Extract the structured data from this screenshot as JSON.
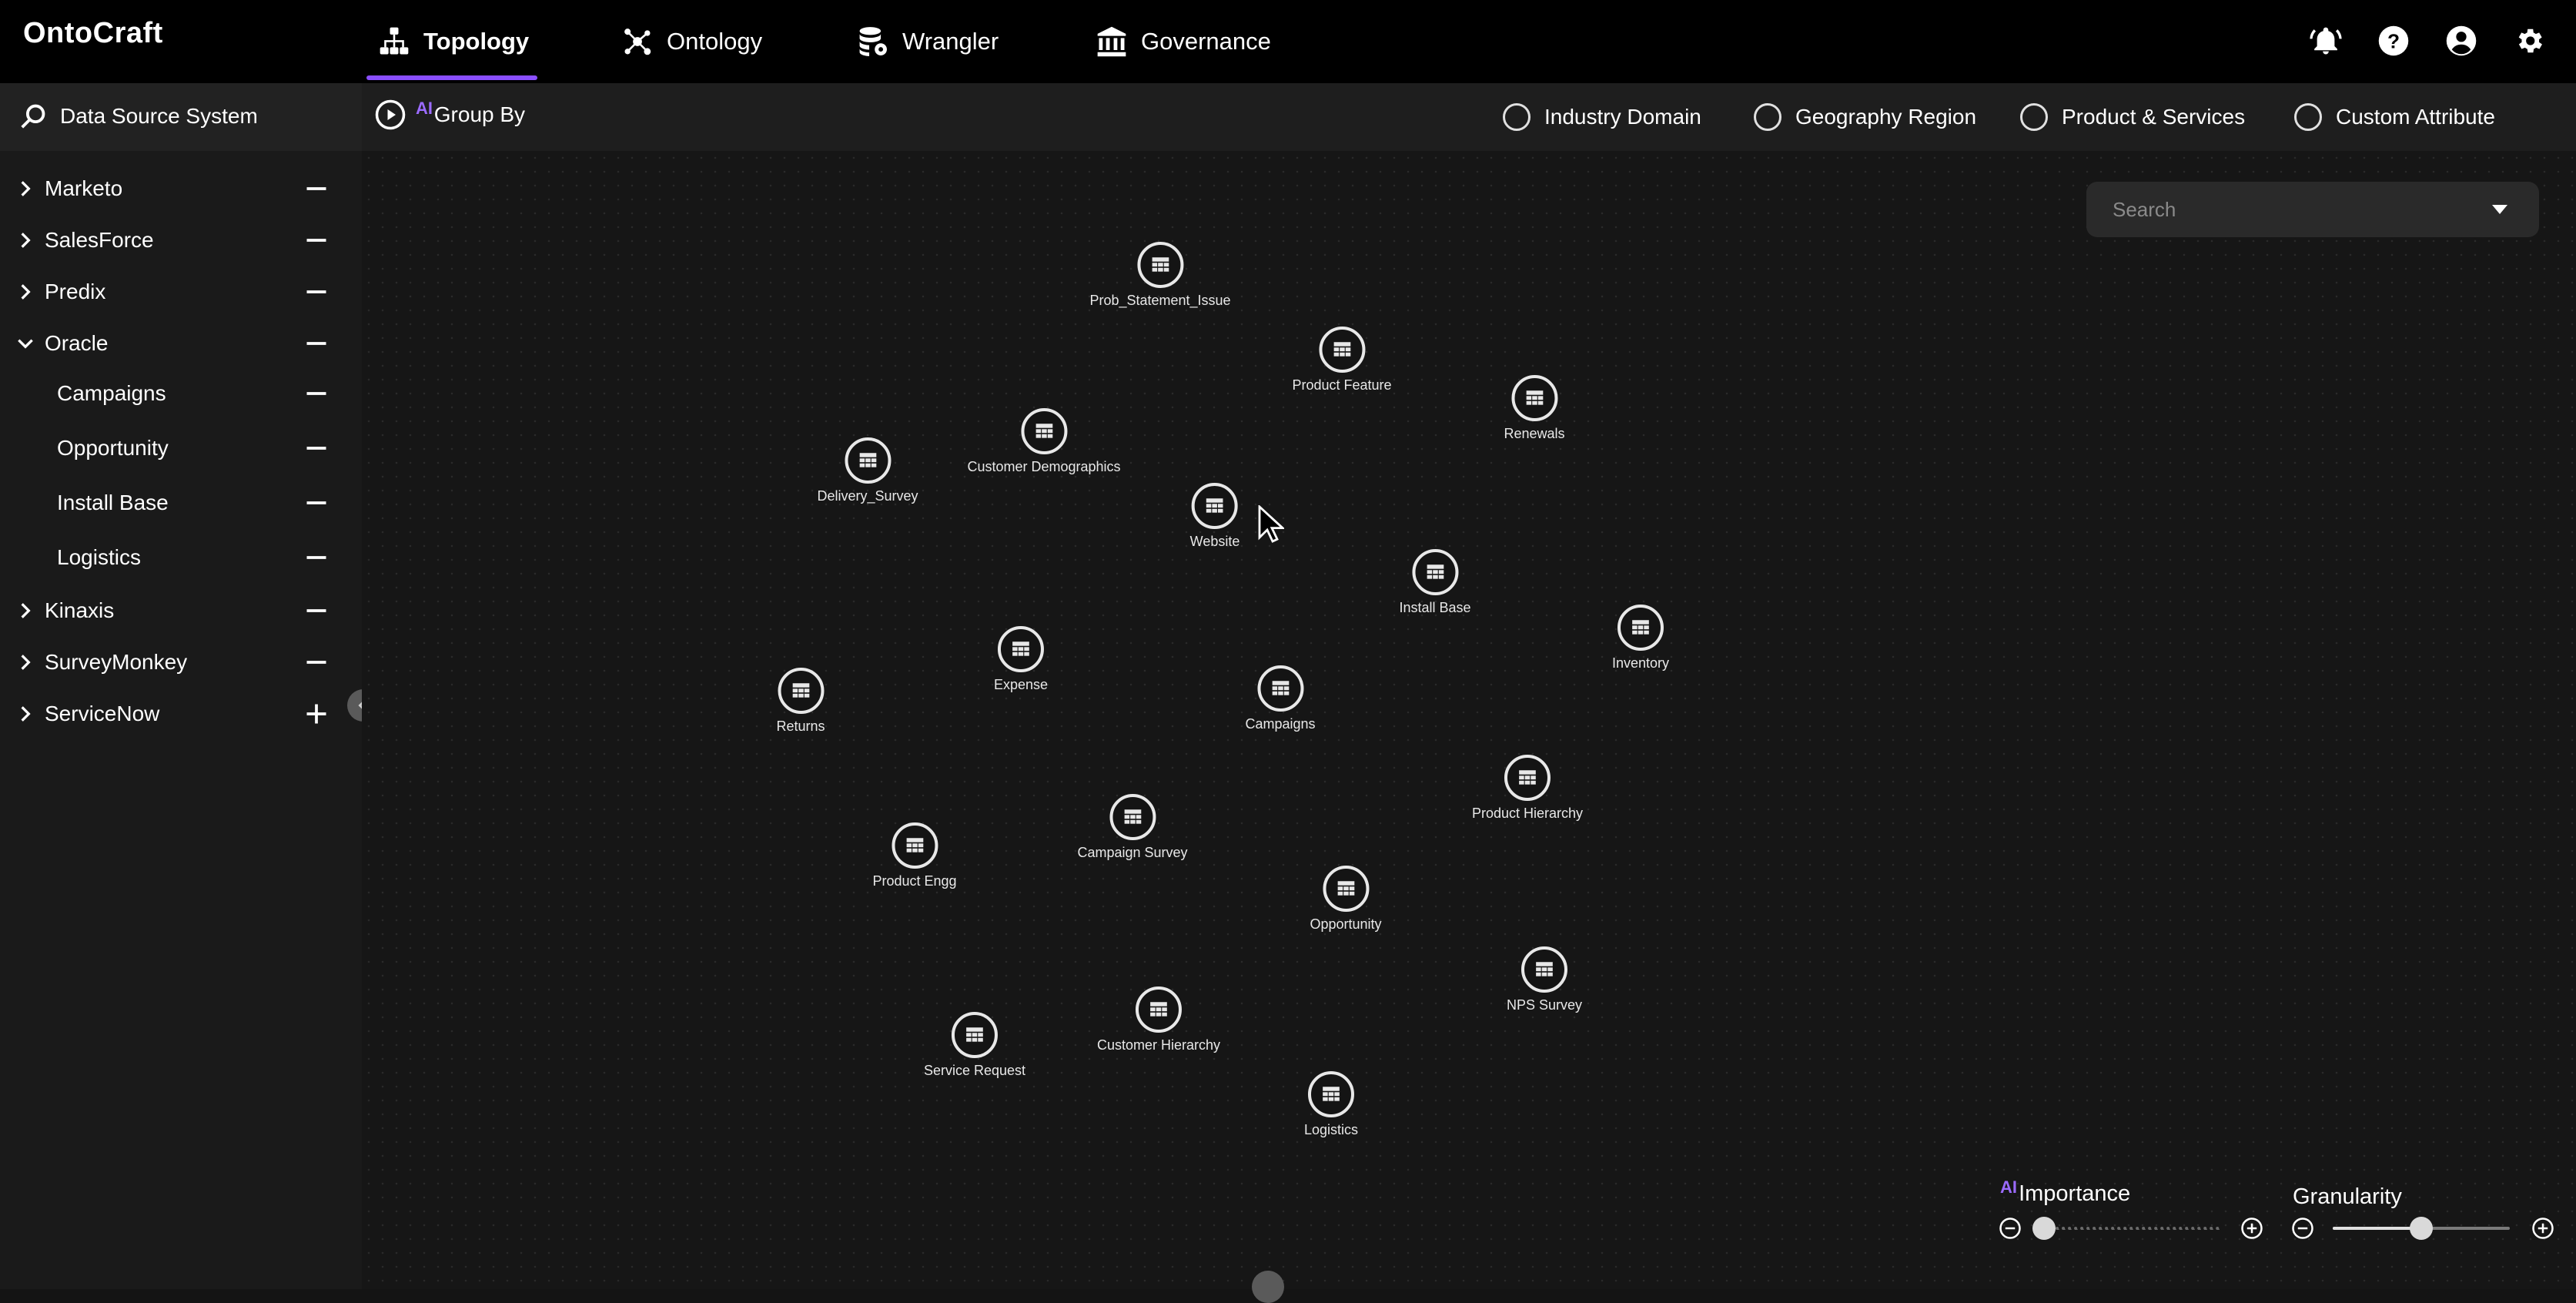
{
  "app": {
    "logo": "OntoCraft",
    "accent": "#8a4fff"
  },
  "nav": {
    "tabs": [
      {
        "label": "Topology",
        "icon": "topology-icon",
        "active": true
      },
      {
        "label": "Ontology",
        "icon": "ontology-icon",
        "active": false
      },
      {
        "label": "Wrangler",
        "icon": "database-gear-icon",
        "active": false
      },
      {
        "label": "Governance",
        "icon": "bank-icon",
        "active": false
      }
    ],
    "right_icons": [
      "bell-icon",
      "help-icon",
      "account-icon",
      "gear-icon"
    ]
  },
  "toolbar": {
    "data_source_label": "Data Source System",
    "ai_tag": "AI",
    "group_by_label": "Group By",
    "group_options": [
      {
        "label": "Industry Domain",
        "selected": false
      },
      {
        "label": "Geography Region",
        "selected": false
      },
      {
        "label": "Product & Services",
        "selected": false
      },
      {
        "label": "Custom Attribute",
        "selected": false
      }
    ]
  },
  "sidebar": {
    "items": [
      {
        "label": "Marketo",
        "expanded": false,
        "action": "minus"
      },
      {
        "label": "SalesForce",
        "expanded": false,
        "action": "minus"
      },
      {
        "label": "Predix",
        "expanded": false,
        "action": "minus"
      },
      {
        "label": "Oracle",
        "expanded": true,
        "action": "minus"
      },
      {
        "label": "Campaigns",
        "child": true,
        "action": "minus"
      },
      {
        "label": "Opportunity",
        "child": true,
        "action": "minus"
      },
      {
        "label": "Install Base",
        "child": true,
        "action": "minus"
      },
      {
        "label": "Logistics",
        "child": true,
        "action": "minus"
      },
      {
        "label": "Kinaxis",
        "expanded": false,
        "action": "minus"
      },
      {
        "label": "SurveyMonkey",
        "expanded": false,
        "action": "minus"
      },
      {
        "label": "ServiceNow",
        "expanded": false,
        "action": "plus"
      }
    ]
  },
  "search": {
    "placeholder": "Search"
  },
  "nodes": [
    {
      "label": "Prob_Statement_Issue"
    },
    {
      "label": "Product Feature"
    },
    {
      "label": "Renewals"
    },
    {
      "label": "Customer Demographics"
    },
    {
      "label": "Delivery_Survey"
    },
    {
      "label": "Website"
    },
    {
      "label": "Install Base"
    },
    {
      "label": "Inventory"
    },
    {
      "label": "Expense"
    },
    {
      "label": "Returns"
    },
    {
      "label": "Campaigns"
    },
    {
      "label": "Product Hierarchy"
    },
    {
      "label": "Campaign Survey"
    },
    {
      "label": "Product Engg"
    },
    {
      "label": "Opportunity"
    },
    {
      "label": "NPS Survey"
    },
    {
      "label": "Customer Hierarchy"
    },
    {
      "label": "Service Request"
    },
    {
      "label": "Logistics"
    }
  ],
  "controls": {
    "importance": {
      "ai_tag": "AI",
      "label": "Importance",
      "value": 0.0
    },
    "granularity": {
      "label": "Granularity",
      "value": 0.5
    }
  }
}
